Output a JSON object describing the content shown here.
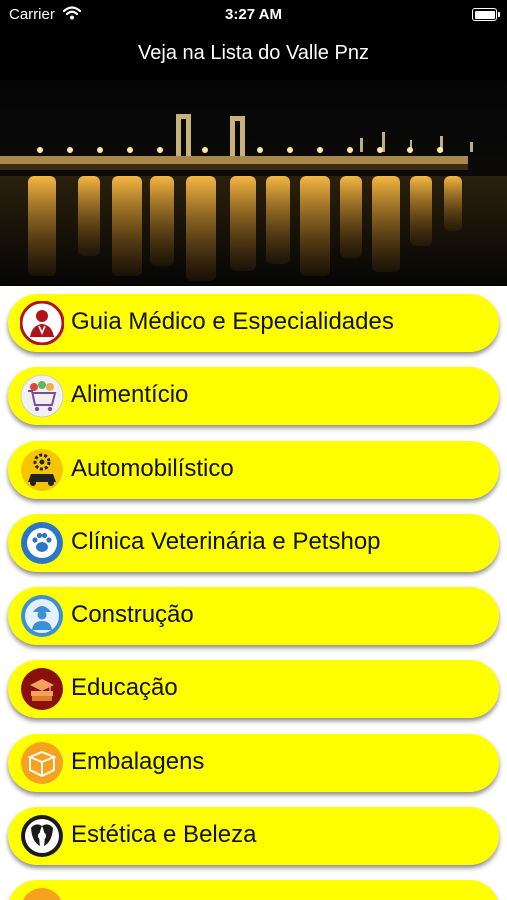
{
  "status_bar": {
    "carrier": "Carrier",
    "time": "3:27 AM"
  },
  "nav": {
    "title": "Veja na Lista do Valle Pnz"
  },
  "menu": {
    "items": [
      {
        "label": "Guia Médico e Especialidades",
        "icon": "doctor-icon"
      },
      {
        "label": "Alimentício",
        "icon": "shopping-cart-icon"
      },
      {
        "label": "Automobilístico",
        "icon": "car-gear-icon"
      },
      {
        "label": "Clínica Veterinária e Petshop",
        "icon": "paw-icon"
      },
      {
        "label": "Construção",
        "icon": "construction-worker-icon"
      },
      {
        "label": "Educação",
        "icon": "books-icon"
      },
      {
        "label": "Embalagens",
        "icon": "box-icon"
      },
      {
        "label": "Estética e Beleza",
        "icon": "beauty-face-icon"
      },
      {
        "label": "",
        "icon": "partial-icon"
      }
    ]
  }
}
